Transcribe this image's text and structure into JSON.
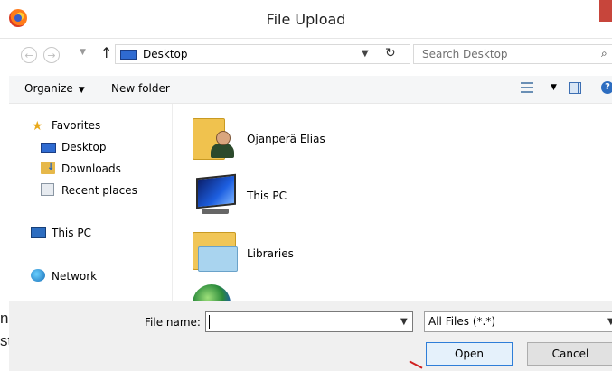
{
  "window": {
    "title": "File Upload"
  },
  "background_page": {
    "line1": "nalta",
    "line2": "sta,"
  },
  "address_bar": {
    "location": "Desktop",
    "search_placeholder": "Search Desktop"
  },
  "toolbar": {
    "organize": "Organize",
    "new_folder": "New folder"
  },
  "nav_pane": {
    "favorites": "Favorites",
    "desktop": "Desktop",
    "downloads": "Downloads",
    "recent_places": "Recent places",
    "this_pc": "This PC",
    "network": "Network"
  },
  "content": {
    "items": [
      {
        "label": "Ojanperä Elias",
        "icon": "user-folder-icon"
      },
      {
        "label": "This PC",
        "icon": "computer-icon"
      },
      {
        "label": "Libraries",
        "icon": "libraries-icon"
      },
      {
        "label": "",
        "icon": "network-globe-icon"
      }
    ]
  },
  "bottom": {
    "file_name_label": "File name:",
    "file_name_value": "",
    "file_type": "All Files (*.*)",
    "open": "Open",
    "cancel": "Cancel"
  },
  "colors": {
    "accent": "#2f7ed8",
    "close_button": "#c7453b",
    "folder": "#f0c24e"
  }
}
